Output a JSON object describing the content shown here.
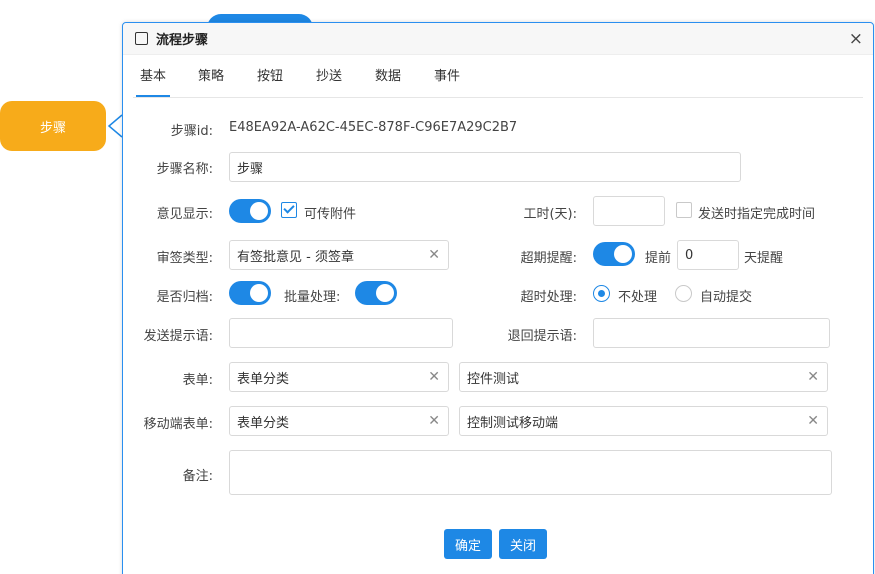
{
  "canvas": {
    "step_node_label": "步骤"
  },
  "dialog": {
    "title": "流程步骤",
    "close_glyph": "×",
    "tabs": [
      {
        "label": "基本",
        "active": true
      },
      {
        "label": "策略"
      },
      {
        "label": "按钮"
      },
      {
        "label": "抄送"
      },
      {
        "label": "数据"
      },
      {
        "label": "事件"
      }
    ],
    "form": {
      "step_id_label": "步骤id:",
      "step_id_value": "E48EA92A-A62C-45EC-878F-C96E7A29C2B7",
      "step_name_label": "步骤名称:",
      "step_name_value": "步骤",
      "opinion_display_label": "意见显示:",
      "opinion_display_on": true,
      "attachments_label": "可传附件",
      "attachments_checked": true,
      "work_hours_label": "工时(天):",
      "work_hours_value": "",
      "send_deadline_label": "发送时指定完成时间",
      "send_deadline_checked": false,
      "sign_type_label": "审签类型:",
      "sign_type_value": "有签批意见 - 须签章",
      "overdue_reminder_label": "超期提醒:",
      "overdue_reminder_on": true,
      "before_label": "提前",
      "before_days_value": "0",
      "days_remind_label": "天提醒",
      "archive_label": "是否归档:",
      "archive_on": true,
      "batch_label": "批量处理:",
      "batch_on": true,
      "timeout_label": "超时处理:",
      "timeout_options": [
        "不处理",
        "自动提交"
      ],
      "timeout_selected": "不处理",
      "send_tip_label": "发送提示语:",
      "send_tip_value": "",
      "return_tip_label": "退回提示语:",
      "return_tip_value": "",
      "form_label": "表单:",
      "form_category_value": "表单分类",
      "form_value": "控件测试",
      "mobile_form_label": "移动端表单:",
      "mobile_form_category_value": "表单分类",
      "mobile_form_value": "控制测试移动端",
      "remark_label": "备注:",
      "remark_value": ""
    },
    "buttons": {
      "confirm": "确定",
      "close": "关闭"
    }
  }
}
